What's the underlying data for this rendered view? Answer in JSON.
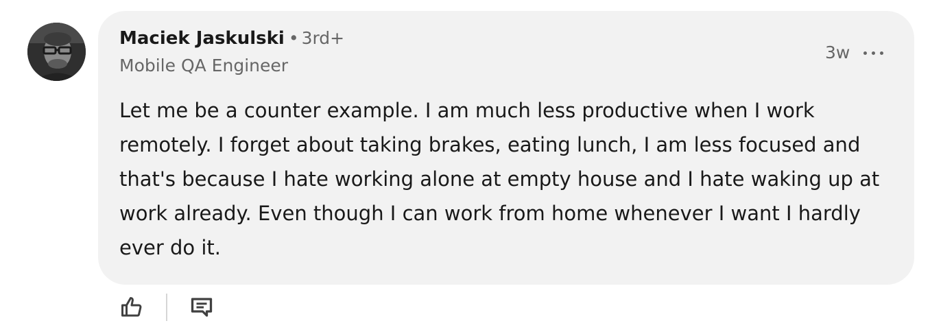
{
  "comment": {
    "author": {
      "name": "Maciek Jaskulski",
      "degree_separator": "•",
      "degree": "3rd+",
      "headline": "Mobile QA Engineer"
    },
    "timestamp": "3w",
    "text": "Let me be a counter example. I am much less productive when I work remotely. I forget about taking brakes, eating lunch, I am less focused and that's because I hate working alone at empty house and I hate waking up at work already. Even though I can work from home whenever I want I hardly ever do it."
  },
  "icons": {
    "avatar": "avatar-photo",
    "more": "ellipsis-icon",
    "like": "thumbs-up-icon",
    "reply": "comment-icon"
  },
  "colors": {
    "bubble_background": "#f2f2f2",
    "primary_text": "#191919",
    "secondary_text": "#666666",
    "icon": "#404040"
  }
}
